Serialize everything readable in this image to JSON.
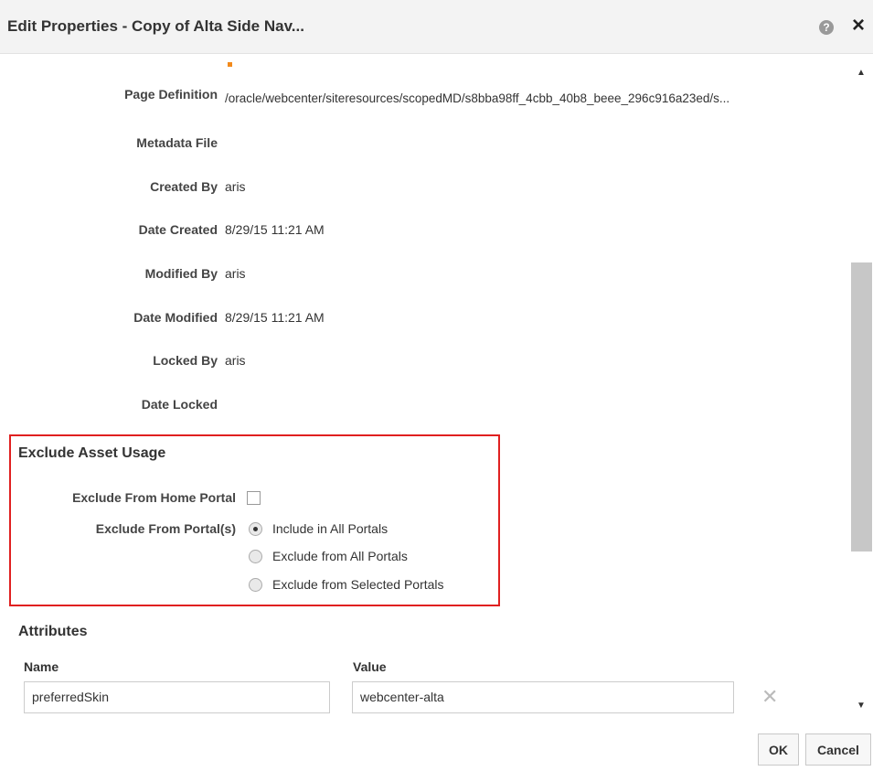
{
  "dialog": {
    "title": "Edit Properties - Copy of Alta Side Nav...",
    "help_icon": "?",
    "close_icon": "×"
  },
  "properties": [
    {
      "label": "Page Definition",
      "value": "/oracle/webcenter/siteresources/scopedMD/s8bba98ff_4cbb_40b8_beee_296c916a23ed/s..."
    },
    {
      "label": "Metadata File",
      "value": ""
    },
    {
      "label": "Created By",
      "value": "aris"
    },
    {
      "label": "Date Created",
      "value": "8/29/15 11:21 AM"
    },
    {
      "label": "Modified By",
      "value": "aris"
    },
    {
      "label": "Date Modified",
      "value": "8/29/15 11:21 AM"
    },
    {
      "label": "Locked By",
      "value": "aris"
    },
    {
      "label": "Date Locked",
      "value": ""
    }
  ],
  "exclude_section": {
    "title": "Exclude Asset Usage",
    "home_portal_label": "Exclude From Home Portal",
    "home_portal_checked": false,
    "portals_label": "Exclude From Portal(s)",
    "options": [
      {
        "label": "Include in All Portals",
        "checked": true
      },
      {
        "label": "Exclude from All Portals",
        "checked": false
      },
      {
        "label": "Exclude from Selected Portals",
        "checked": false
      }
    ]
  },
  "attributes": {
    "title": "Attributes",
    "name_header": "Name",
    "value_header": "Value",
    "name_value": "preferredSkin",
    "value_value": "webcenter-alta",
    "remove_icon": "✕"
  },
  "scrollbar": {
    "up_icon": "▲",
    "down_icon": "▼"
  },
  "buttons": {
    "ok": "OK",
    "cancel": "Cancel"
  },
  "colors": {
    "highlight": "#e02020",
    "marker": "#f28a1c"
  }
}
